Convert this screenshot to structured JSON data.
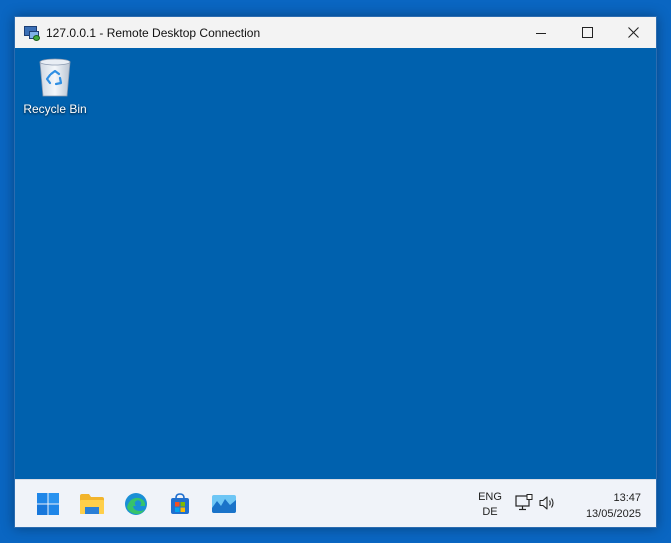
{
  "window": {
    "title": "127.0.0.1 - Remote Desktop Connection",
    "controls": [
      "minimize",
      "maximize",
      "close"
    ]
  },
  "desktop": {
    "icons": [
      {
        "label": "Recycle Bin",
        "icon": "recycle-bin-icon"
      }
    ],
    "background_color": "#0061ae"
  },
  "taskbar": {
    "apps": [
      {
        "name": "start",
        "icon": "windows-start-icon"
      },
      {
        "name": "file-explorer",
        "icon": "folder-icon"
      },
      {
        "name": "edge",
        "icon": "edge-icon"
      },
      {
        "name": "store",
        "icon": "store-icon"
      },
      {
        "name": "app",
        "icon": "image-app-icon"
      }
    ],
    "tray": {
      "lang_line1": "ENG",
      "lang_line2": "DE",
      "time": "13:47",
      "date": "13/05/2025"
    }
  }
}
